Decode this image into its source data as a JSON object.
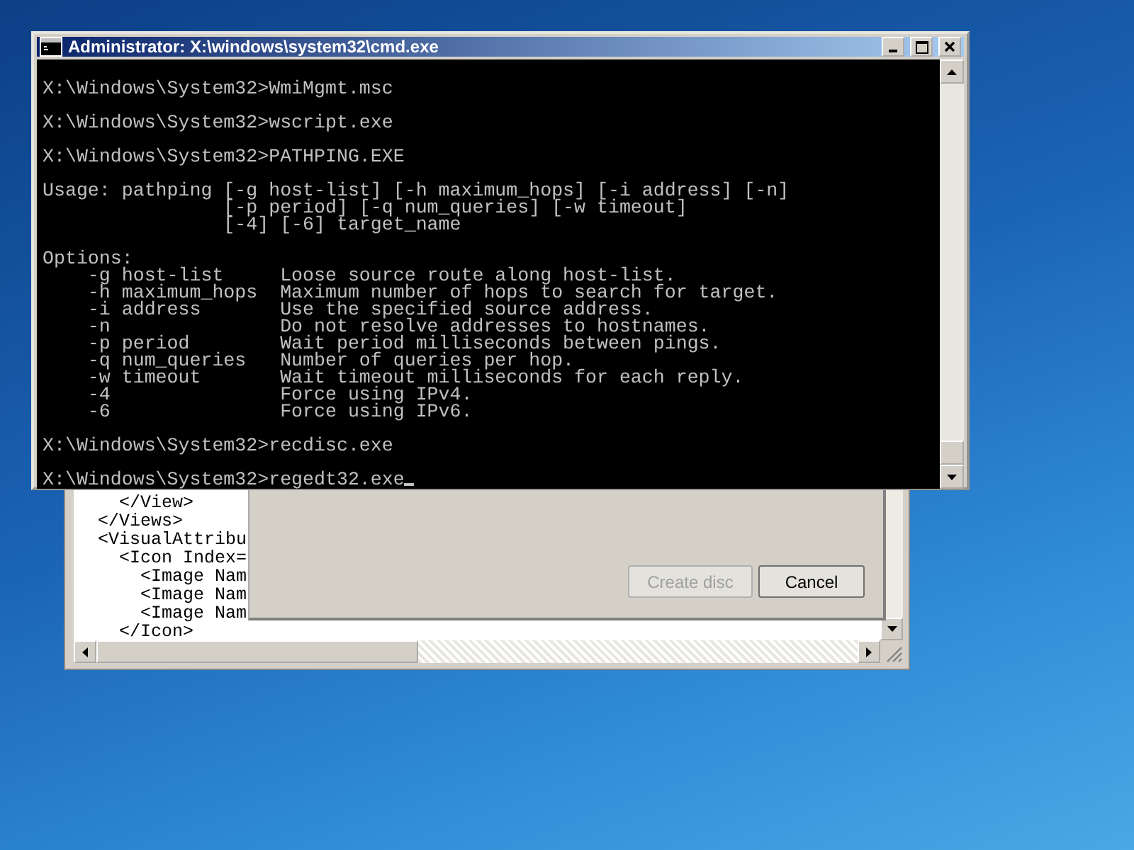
{
  "cmd_window": {
    "title": "Administrator: X:\\windows\\system32\\cmd.exe",
    "blocks": [
      [
        "X:\\Windows\\System32>WmiMgmt.msc"
      ],
      [
        "X:\\Windows\\System32>wscript.exe"
      ],
      [
        "X:\\Windows\\System32>PATHPING.EXE"
      ],
      [
        "Usage: pathping [-g host-list] [-h maximum_hops] [-i address] [-n]",
        "                [-p period] [-q num_queries] [-w timeout]",
        "                [-4] [-6] target_name"
      ],
      [
        "Options:",
        "    -g host-list     Loose source route along host-list.",
        "    -h maximum_hops  Maximum number of hops to search for target.",
        "    -i address       Use the specified source address.",
        "    -n               Do not resolve addresses to hostnames.",
        "    -p period        Wait period milliseconds between pings.",
        "    -q num_queries   Number of queries per hop.",
        "    -w timeout       Wait timeout milliseconds for each reply.",
        "    -4               Force using IPv4.",
        "    -6               Force using IPv6."
      ],
      [
        "X:\\Windows\\System32>recdisc.exe"
      ],
      [
        "X:\\Windows\\System32>regedt32.exe"
      ]
    ],
    "cursor": true
  },
  "xml_window": {
    "lines": [
      "    </View>",
      "  </Views>",
      "  <VisualAttribu",
      "    <Icon Index=",
      "      <Image Nam",
      "      <Image Nam",
      "      <Image Nam",
      "    </Icon>"
    ]
  },
  "dialog": {
    "buttons": [
      {
        "label": "Create disc",
        "disabled": true
      },
      {
        "label": "Cancel",
        "disabled": false
      }
    ]
  }
}
